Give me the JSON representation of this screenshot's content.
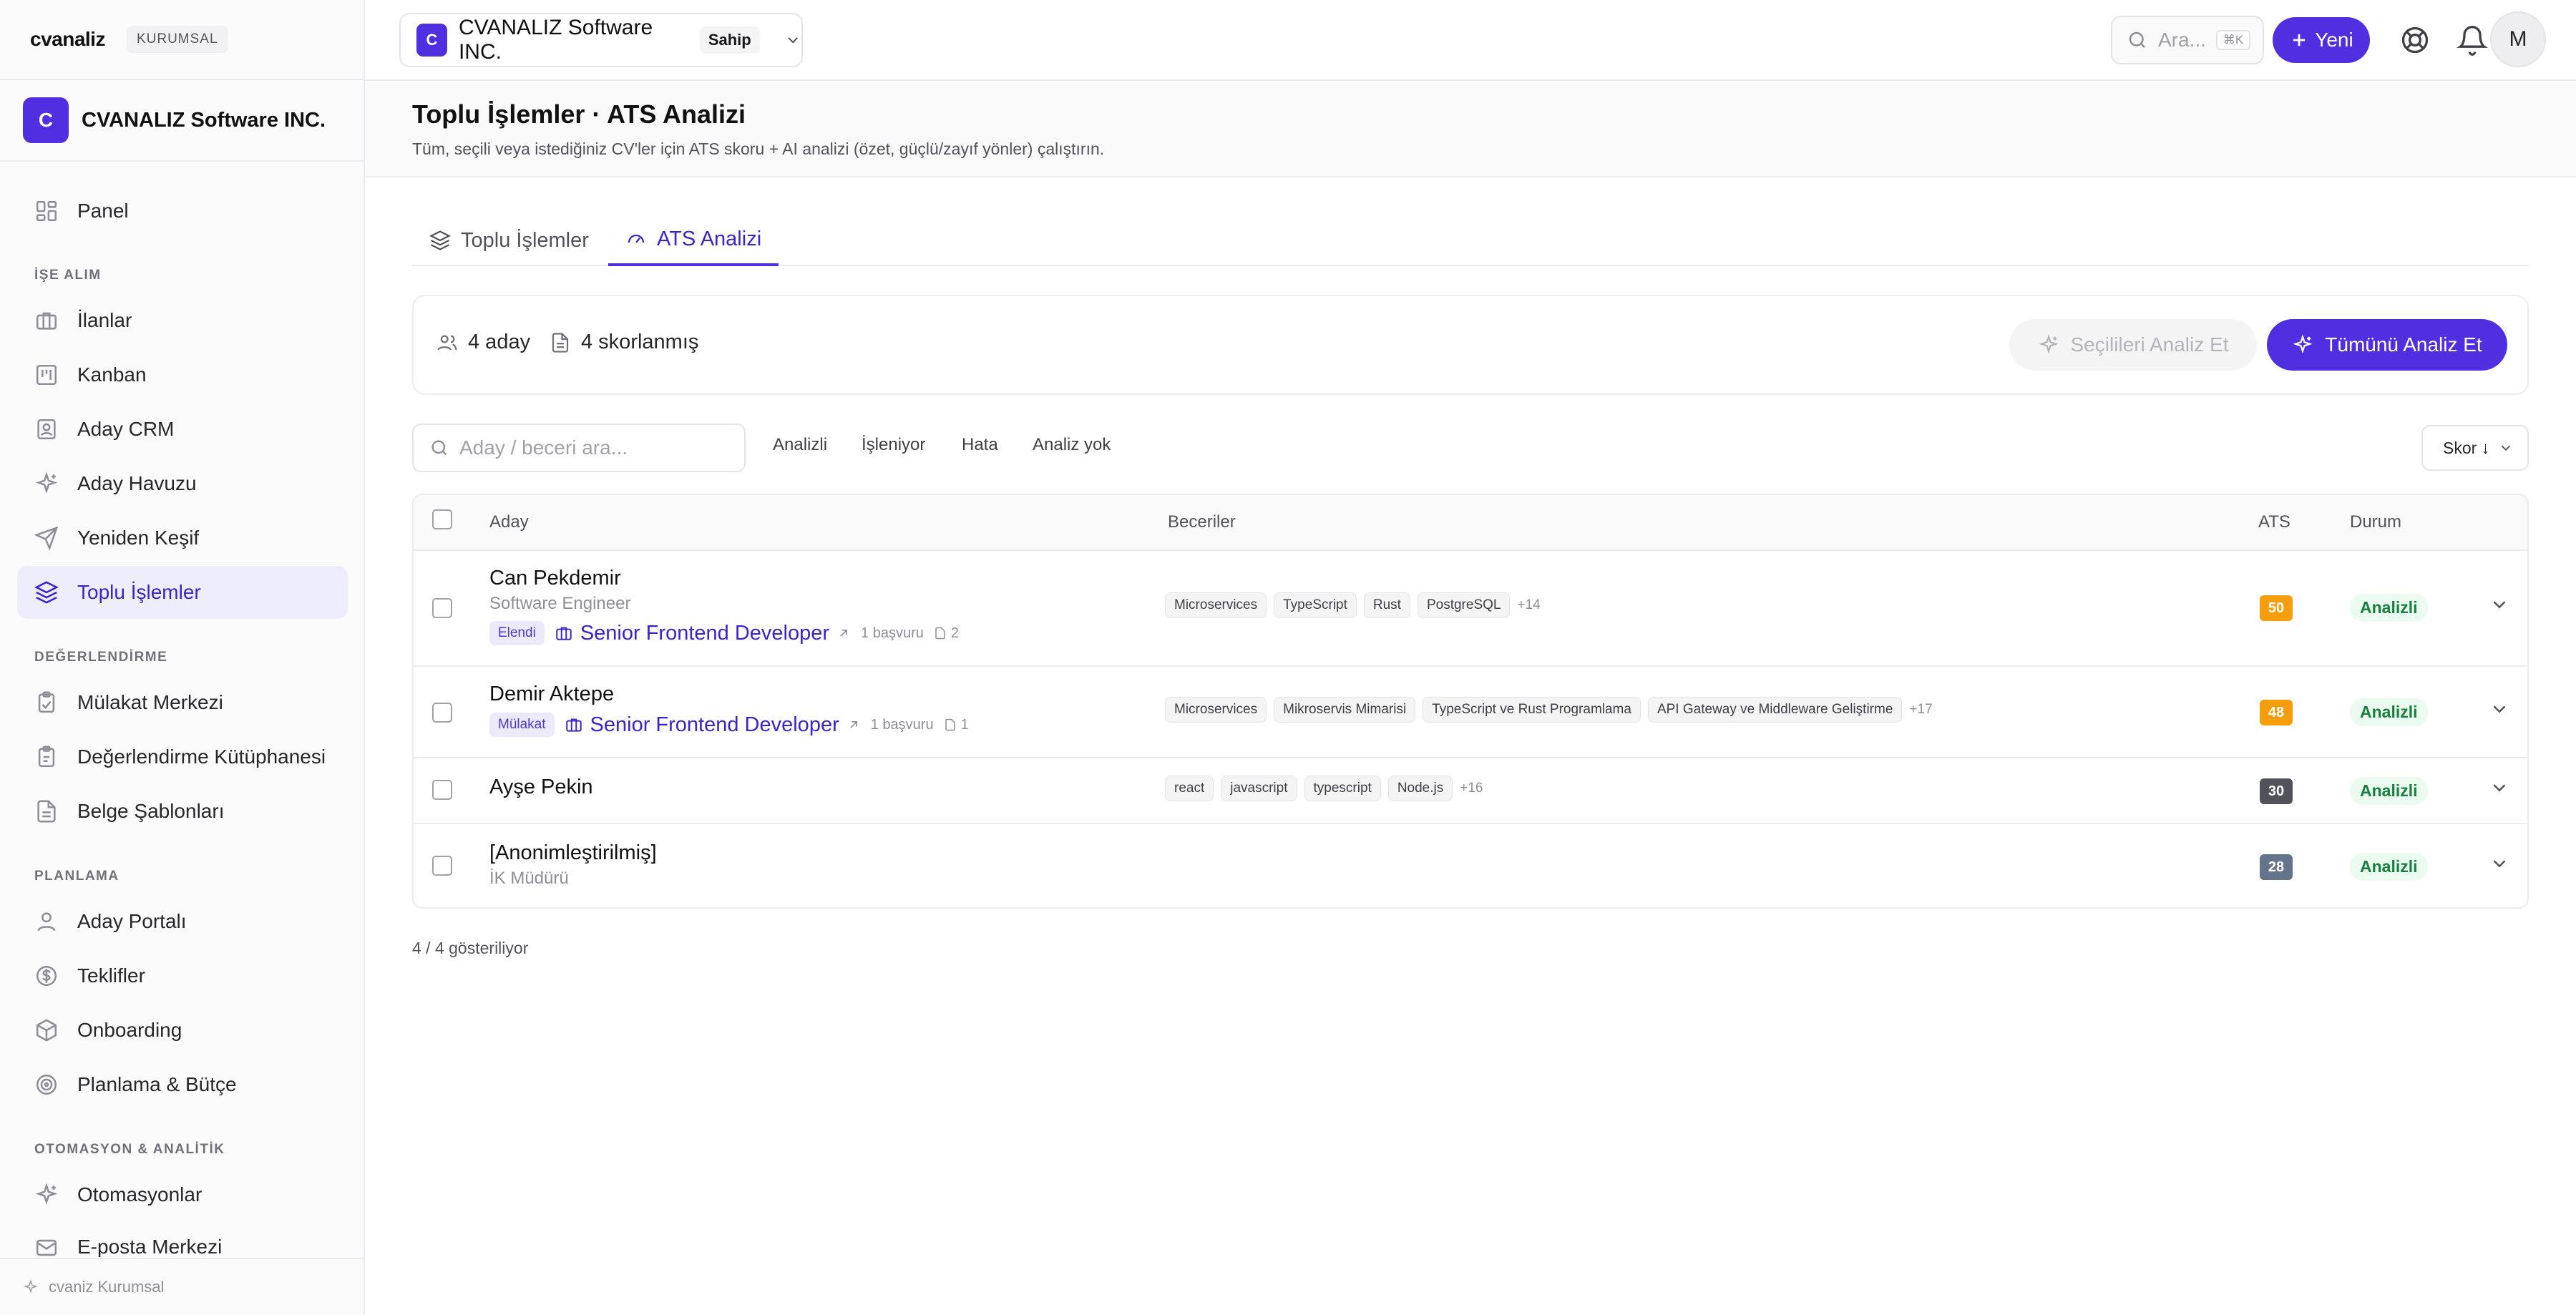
{
  "brand": {
    "logo": "cvanaliz",
    "badge": "KURUMSAL"
  },
  "org": {
    "avatar": "C",
    "name": "CVANALIZ Software INC.",
    "role": "Sahip"
  },
  "sidebar": {
    "items": [
      {
        "label": "Panel",
        "icon": "grid-icon"
      },
      {
        "label": "İlanlar",
        "icon": "briefcase-icon"
      },
      {
        "label": "Kanban",
        "icon": "kanban-icon"
      },
      {
        "label": "Aday CRM",
        "icon": "contact-icon"
      },
      {
        "label": "Aday Havuzu",
        "icon": "sparkles-icon"
      },
      {
        "label": "Yeniden Keşif",
        "icon": "send-icon"
      },
      {
        "label": "Toplu İşlemler",
        "icon": "layers-icon"
      },
      {
        "label": "Mülakat Merkezi",
        "icon": "clipboard-icon"
      },
      {
        "label": "Değerlendirme Kütüphanesi",
        "icon": "clipboard-check-icon"
      },
      {
        "label": "Belge Şablonları",
        "icon": "file-icon"
      },
      {
        "label": "Aday Portalı",
        "icon": "user-icon"
      },
      {
        "label": "Teklifler",
        "icon": "dollar-icon"
      },
      {
        "label": "Onboarding",
        "icon": "package-icon"
      },
      {
        "label": "Planlama & Bütçe",
        "icon": "target-icon"
      },
      {
        "label": "Otomasyonlar",
        "icon": "sparkles-icon"
      },
      {
        "label": "E-posta Merkezi",
        "icon": "mail-icon"
      }
    ],
    "sections": [
      "İŞE ALIM",
      "DEĞERLENDİRME",
      "PLANLAMA",
      "OTOMASYON & ANALİTİK"
    ],
    "footer": "cvaniz Kurumsal"
  },
  "topbar": {
    "search_placeholder": "Ara...",
    "search_kbd": "⌘K",
    "new_label": "Yeni",
    "avatar": "M"
  },
  "page": {
    "title": "Toplu İşlemler · ATS Analizi",
    "subtitle": "Tüm, seçili veya istediğiniz CV'ler için ATS skoru + AI analizi (özet, güçlü/zayıf yönler) çalıştırın."
  },
  "tabs": [
    {
      "label": "Toplu İşlemler"
    },
    {
      "label": "ATS Analizi"
    }
  ],
  "stats": {
    "candidates": "4 aday",
    "scored": "4 skorlanmış"
  },
  "actions": {
    "analyze_selected": "Seçilileri Analiz Et",
    "analyze_all": "Tümünü Analiz Et"
  },
  "filters": {
    "search_placeholder": "Aday / beceri ara...",
    "chips": [
      "Analizli",
      "İşleniyor",
      "Hata",
      "Analiz yok"
    ],
    "sort": "Skor ↓"
  },
  "table": {
    "headers": {
      "candidate": "Aday",
      "skills": "Beceriler",
      "ats": "ATS",
      "status": "Durum"
    },
    "rows": [
      {
        "name": "Can Pekdemir",
        "title": "Software Engineer",
        "stage": "Elendi",
        "job": "Senior Frontend Developer",
        "applications": "1 başvuru",
        "docs": "2",
        "skills": [
          "Microservices",
          "TypeScript",
          "Rust",
          "PostgreSQL"
        ],
        "more": "+14",
        "ats": "50",
        "ats_color": "#f59e0b",
        "status": "Analizli"
      },
      {
        "name": "Demir Aktepe",
        "title": "",
        "stage": "Mülakat",
        "job": "Senior Frontend Developer",
        "applications": "1 başvuru",
        "docs": "1",
        "skills": [
          "Microservices",
          "Mikroservis Mimarisi",
          "TypeScript ve Rust Programlama",
          "API Gateway ve Middleware Geliştirme"
        ],
        "more": "+17",
        "ats": "48",
        "ats_color": "#f59e0b",
        "status": "Analizli"
      },
      {
        "name": "Ayşe Pekin",
        "title": "",
        "skills": [
          "react",
          "javascript",
          "typescript",
          "Node.js"
        ],
        "more": "+16",
        "ats": "30",
        "ats_color": "#52525b",
        "status": "Analizli"
      },
      {
        "name": "[Anonimleştirilmiş]",
        "title": "İK Müdürü",
        "skills": [],
        "more": "",
        "ats": "28",
        "ats_color": "#64748b",
        "status": "Analizli"
      }
    ]
  },
  "footer_count": "4 / 4 gösteriliyor",
  "colors": {
    "accent": "#4f2fe0",
    "success": "#15803d",
    "warning": "#f59e0b"
  }
}
